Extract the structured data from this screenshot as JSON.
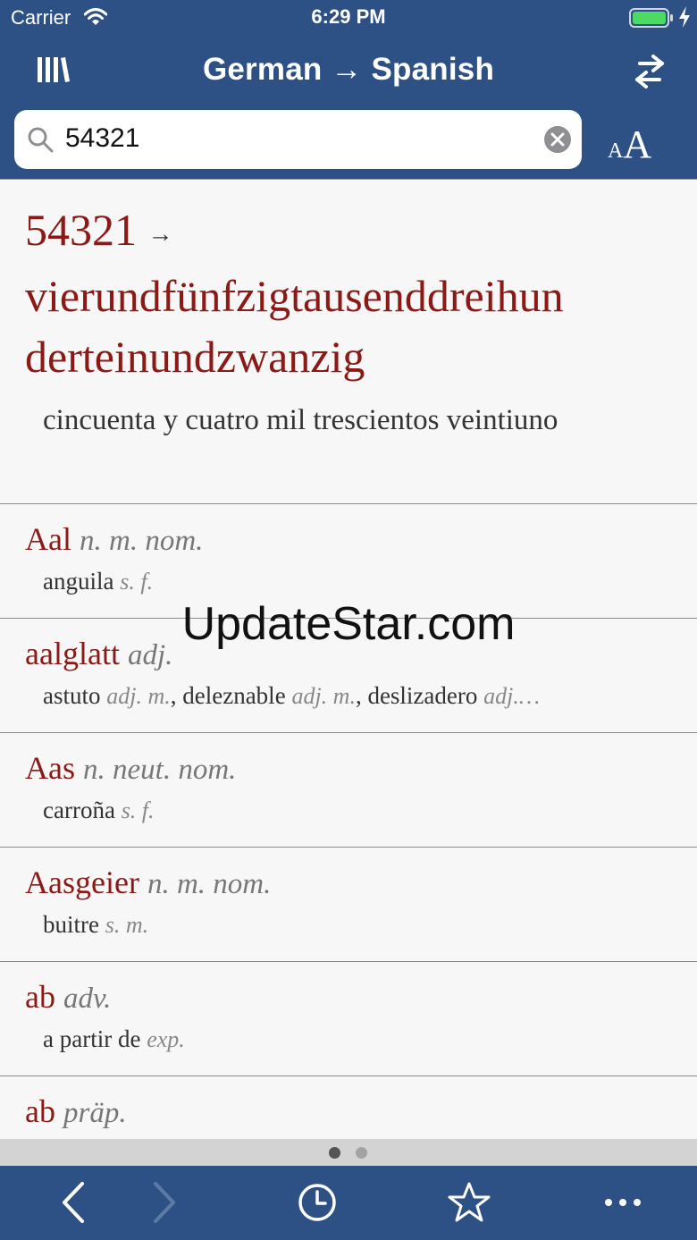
{
  "status_bar": {
    "carrier": "Carrier",
    "time": "6:29 PM"
  },
  "nav": {
    "title": "German → Spanish"
  },
  "search": {
    "value": "54321"
  },
  "font_size_control": {
    "small": "A",
    "big": "A"
  },
  "main_entry": {
    "number": "54321",
    "arrow": "→",
    "headword_line1": "vierundfünfzigtausenddreihun",
    "headword_line2": "derteinundzwanzig",
    "translation": "cincuenta y cuatro mil trescientos veintiuno"
  },
  "entries": [
    {
      "headword": "Aal",
      "pos": "n. m. nom.",
      "translations": [
        {
          "word": "anguila",
          "pos": "s. f."
        }
      ]
    },
    {
      "headword": "aalglatt",
      "pos": "adj.",
      "translations": [
        {
          "word": "astuto",
          "pos": "adj. m.",
          "sep": ", "
        },
        {
          "word": "deleznable",
          "pos": "adj. m.",
          "sep": ", "
        },
        {
          "word": "deslizadero",
          "pos": "adj.…"
        }
      ]
    },
    {
      "headword": "Aas",
      "pos": "n. neut. nom.",
      "translations": [
        {
          "word": "carroña",
          "pos": "s. f."
        }
      ]
    },
    {
      "headword": "Aasgeier",
      "pos": "n. m. nom.",
      "translations": [
        {
          "word": "buitre",
          "pos": "s. m."
        }
      ]
    },
    {
      "headword": "ab",
      "pos": "adv.",
      "translations": [
        {
          "word": "a partir de",
          "pos": "exp."
        }
      ]
    },
    {
      "headword": "ab",
      "pos": "präp.",
      "translations": []
    }
  ],
  "page_indicator": {
    "total": 2,
    "current": 1
  },
  "watermark": "UpdateStar.com",
  "colors": {
    "bar": "#2e5185",
    "headword": "#8b1a17",
    "background": "#f7f7f7"
  },
  "icons": [
    "wifi-icon",
    "battery-icon",
    "library-icon",
    "swap-icon",
    "search-icon",
    "clear-icon",
    "back-icon",
    "forward-icon",
    "history-icon",
    "favorites-icon",
    "more-icon"
  ]
}
